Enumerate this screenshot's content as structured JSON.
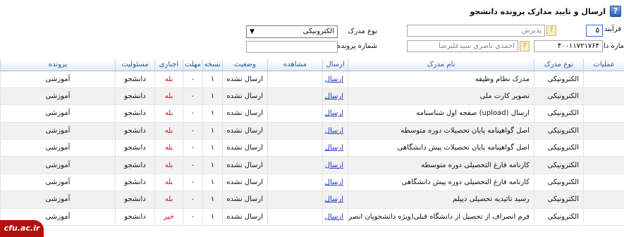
{
  "header": {
    "title": "ارسال و تایید مدارک پرونده دانشجو",
    "help_glyph": "?"
  },
  "form": {
    "process_label": "فرآیند",
    "process_code": "۵",
    "process_name": "پذیرش",
    "student_no_label": "ماره دانشجو",
    "student_no": "۴۰۰۱۱۷۲۱۷۶۴",
    "student_name": "احمدی ناصری سیدعلیرضا",
    "doc_type_label": "نوع مدرک",
    "doc_type_selected": "الکترونیکی",
    "file_no_label": "شماره پرونده",
    "file_no": "",
    "lookup_glyph": "?"
  },
  "table": {
    "headers": [
      "عملیات",
      "نوع مدرک",
      "نام مدرک",
      "ارسال",
      "مشاهده",
      "وضعیت",
      "نسخه",
      "مهلت",
      "اجباری",
      "مسئولیت",
      "پرونده"
    ],
    "rows": [
      {
        "type": "الکترونیکی",
        "name": "مدرک نظام وظیفه",
        "send": "ارسال",
        "status": "ارسال نشده",
        "copies": "۱",
        "deadline": "۰",
        "mandatory": "بله",
        "responsible": "دانشجو",
        "file": "آموزشی"
      },
      {
        "type": "الکترونیکی",
        "name": "تصویر کارت ملی",
        "send": "ارسال",
        "status": "ارسال نشده",
        "copies": "۱",
        "deadline": "۰",
        "mandatory": "بله",
        "responsible": "دانشجو",
        "file": "آموزشی"
      },
      {
        "type": "الکترونیکی",
        "name": "ارسال (upload) صفحه اول شناسنامه",
        "send": "ارسال",
        "status": "ارسال نشده",
        "copies": "۱",
        "deadline": "۰",
        "mandatory": "بله",
        "responsible": "دانشجو",
        "file": "آموزشی"
      },
      {
        "type": "الکترونیکی",
        "name": "اصل گواهینامه پایان تحصیلات دوره متوسطه",
        "send": "ارسال",
        "status": "ارسال نشده",
        "copies": "۱",
        "deadline": "۰",
        "mandatory": "بله",
        "responsible": "دانشجو",
        "file": "آموزشی"
      },
      {
        "type": "الکترونیکی",
        "name": "اصل گواهینامه پایان تحصیلات پیش دانشگاهی",
        "send": "ارسال",
        "status": "ارسال نشده",
        "copies": "۱",
        "deadline": "۰",
        "mandatory": "بله",
        "responsible": "دانشجو",
        "file": "آموزشی"
      },
      {
        "type": "الکترونیکی",
        "name": "کارنامه فارغ التحصیلی دوره متوسطه",
        "send": "ارسال",
        "status": "ارسال نشده",
        "copies": "۱",
        "deadline": "۰",
        "mandatory": "بله",
        "responsible": "دانشجو",
        "file": "آموزشی"
      },
      {
        "type": "الکترونیکی",
        "name": "کارنامه فارغ التحصیلی دوره پیش دانشگاهی",
        "send": "ارسال",
        "status": "ارسال نشده",
        "copies": "۱",
        "deadline": "۰",
        "mandatory": "بله",
        "responsible": "دانشجو",
        "file": "آموزشی"
      },
      {
        "type": "الکترونیکی",
        "name": "رسید تائیدیه تحصیلی دیپلم",
        "send": "ارسال",
        "status": "ارسال نشده",
        "copies": "۱",
        "deadline": "۰",
        "mandatory": "بله",
        "responsible": "دانشجو",
        "file": "آموزشی"
      },
      {
        "type": "الکترونیکی",
        "name": "فرم انصراف از تحصیل از دانشگاه قبلی(ویژه دانشجویان انصرافی)",
        "send": "ارسال",
        "status": "ارسال نشده",
        "copies": "۱",
        "deadline": "۰",
        "mandatory": "خیر",
        "responsible": "دانشجو",
        "file": "آموزشی"
      }
    ]
  },
  "watermark": "cfu.ac.ir"
}
